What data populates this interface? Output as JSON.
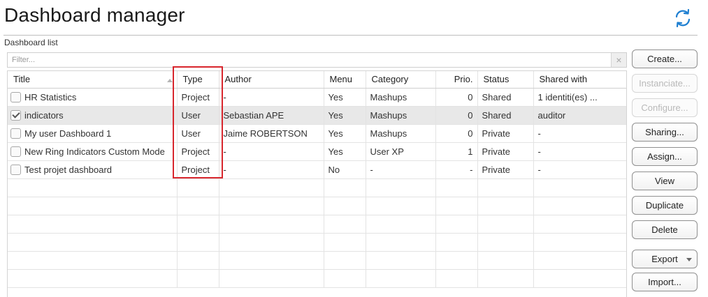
{
  "header": {
    "title": "Dashboard manager",
    "section_label": "Dashboard list"
  },
  "icons": {
    "refresh": "refresh-icon",
    "filter_clear": "close-icon",
    "sort": "sort-ascending-icon",
    "checkbox": "checkbox-icon"
  },
  "colors": {
    "accent": "#1e7fd1",
    "highlight_border": "#d8262d",
    "selected_row": "#e8e8e8"
  },
  "filter": {
    "placeholder": "Filter...",
    "clear_label": "×"
  },
  "table": {
    "columns": {
      "title": "Title",
      "type": "Type",
      "author": "Author",
      "menu": "Menu",
      "category": "Category",
      "prio": "Prio.",
      "status": "Status",
      "shared_with": "Shared with"
    },
    "rows": [
      {
        "checked": false,
        "title": "HR Statistics",
        "type": "Project",
        "author": "-",
        "menu": "Yes",
        "category": "Mashups",
        "prio": "0",
        "status": "Shared",
        "shared_with": "1 identiti(es) ..."
      },
      {
        "checked": true,
        "title": "indicators",
        "type": "User",
        "author": "Sebastian APE",
        "menu": "Yes",
        "category": "Mashups",
        "prio": "0",
        "status": "Shared",
        "shared_with": "auditor"
      },
      {
        "checked": false,
        "title": "My user Dashboard 1",
        "type": "User",
        "author": "Jaime ROBERTSON",
        "menu": "Yes",
        "category": "Mashups",
        "prio": "0",
        "status": "Private",
        "shared_with": "-"
      },
      {
        "checked": false,
        "title": "New Ring Indicators Custom Mode",
        "type": "Project",
        "author": "-",
        "menu": "Yes",
        "category": "User XP",
        "prio": "1",
        "status": "Private",
        "shared_with": "-"
      },
      {
        "checked": false,
        "title": "Test projet dashboard",
        "type": "Project",
        "author": "-",
        "menu": "No",
        "category": "-",
        "prio": "-",
        "status": "Private",
        "shared_with": "-"
      }
    ],
    "selected_row": 1
  },
  "buttons": {
    "create": "Create...",
    "instanciate": "Instanciate...",
    "configure": "Configure...",
    "sharing": "Sharing...",
    "assign": "Assign...",
    "view": "View",
    "duplicate": "Duplicate",
    "delete": "Delete",
    "export": "Export",
    "import": "Import..."
  }
}
